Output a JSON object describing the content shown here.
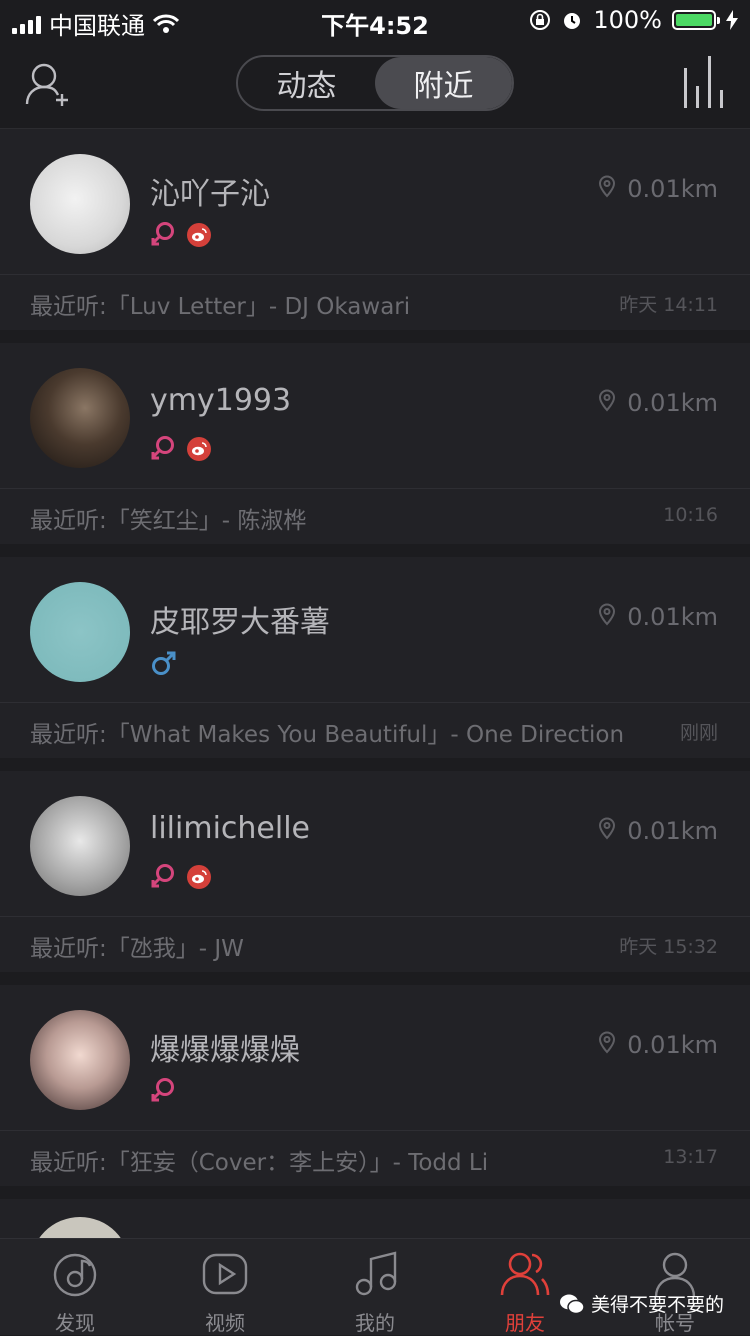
{
  "status": {
    "carrier": "中国联通",
    "time": "下午4:52",
    "battery": "100%"
  },
  "nav": {
    "tabs": [
      "动态",
      "附近"
    ],
    "active_index": 1
  },
  "users": [
    {
      "name": "沁吖子沁",
      "gender": "female",
      "weibo": true,
      "distance": "0.01km",
      "recent": "最近听:「Luv Letter」- DJ Okawari",
      "time": "昨天 14:11"
    },
    {
      "name": "ymy1993",
      "gender": "female",
      "weibo": true,
      "distance": "0.01km",
      "recent": "最近听:「笑红尘」- 陈淑桦",
      "time": "10:16"
    },
    {
      "name": "皮耶罗大番薯",
      "gender": "male",
      "weibo": false,
      "distance": "0.01km",
      "recent": "最近听:「What Makes You Beautiful」- One Direction",
      "time": "刚刚"
    },
    {
      "name": "lilimichelle",
      "gender": "female",
      "weibo": true,
      "distance": "0.01km",
      "recent": "最近听:「氹我」- JW",
      "time": "昨天 15:32"
    },
    {
      "name": "爆爆爆爆燥",
      "gender": "female",
      "weibo": false,
      "distance": "0.01km",
      "recent": "最近听:「狂妄（Cover：李上安）」- Todd Li",
      "time": "13:17"
    }
  ],
  "tabbar": [
    {
      "label": "发现",
      "icon": "discover-icon"
    },
    {
      "label": "视频",
      "icon": "video-icon"
    },
    {
      "label": "我的",
      "icon": "music-icon"
    },
    {
      "label": "朋友",
      "icon": "friends-icon",
      "active": true
    },
    {
      "label": "帐号",
      "icon": "account-icon"
    }
  ],
  "watermark": "美得不要不要的",
  "colors": {
    "accent": "#e0403a",
    "female": "#d5457c",
    "male": "#4a90c8",
    "weibo": "#d4403a"
  }
}
